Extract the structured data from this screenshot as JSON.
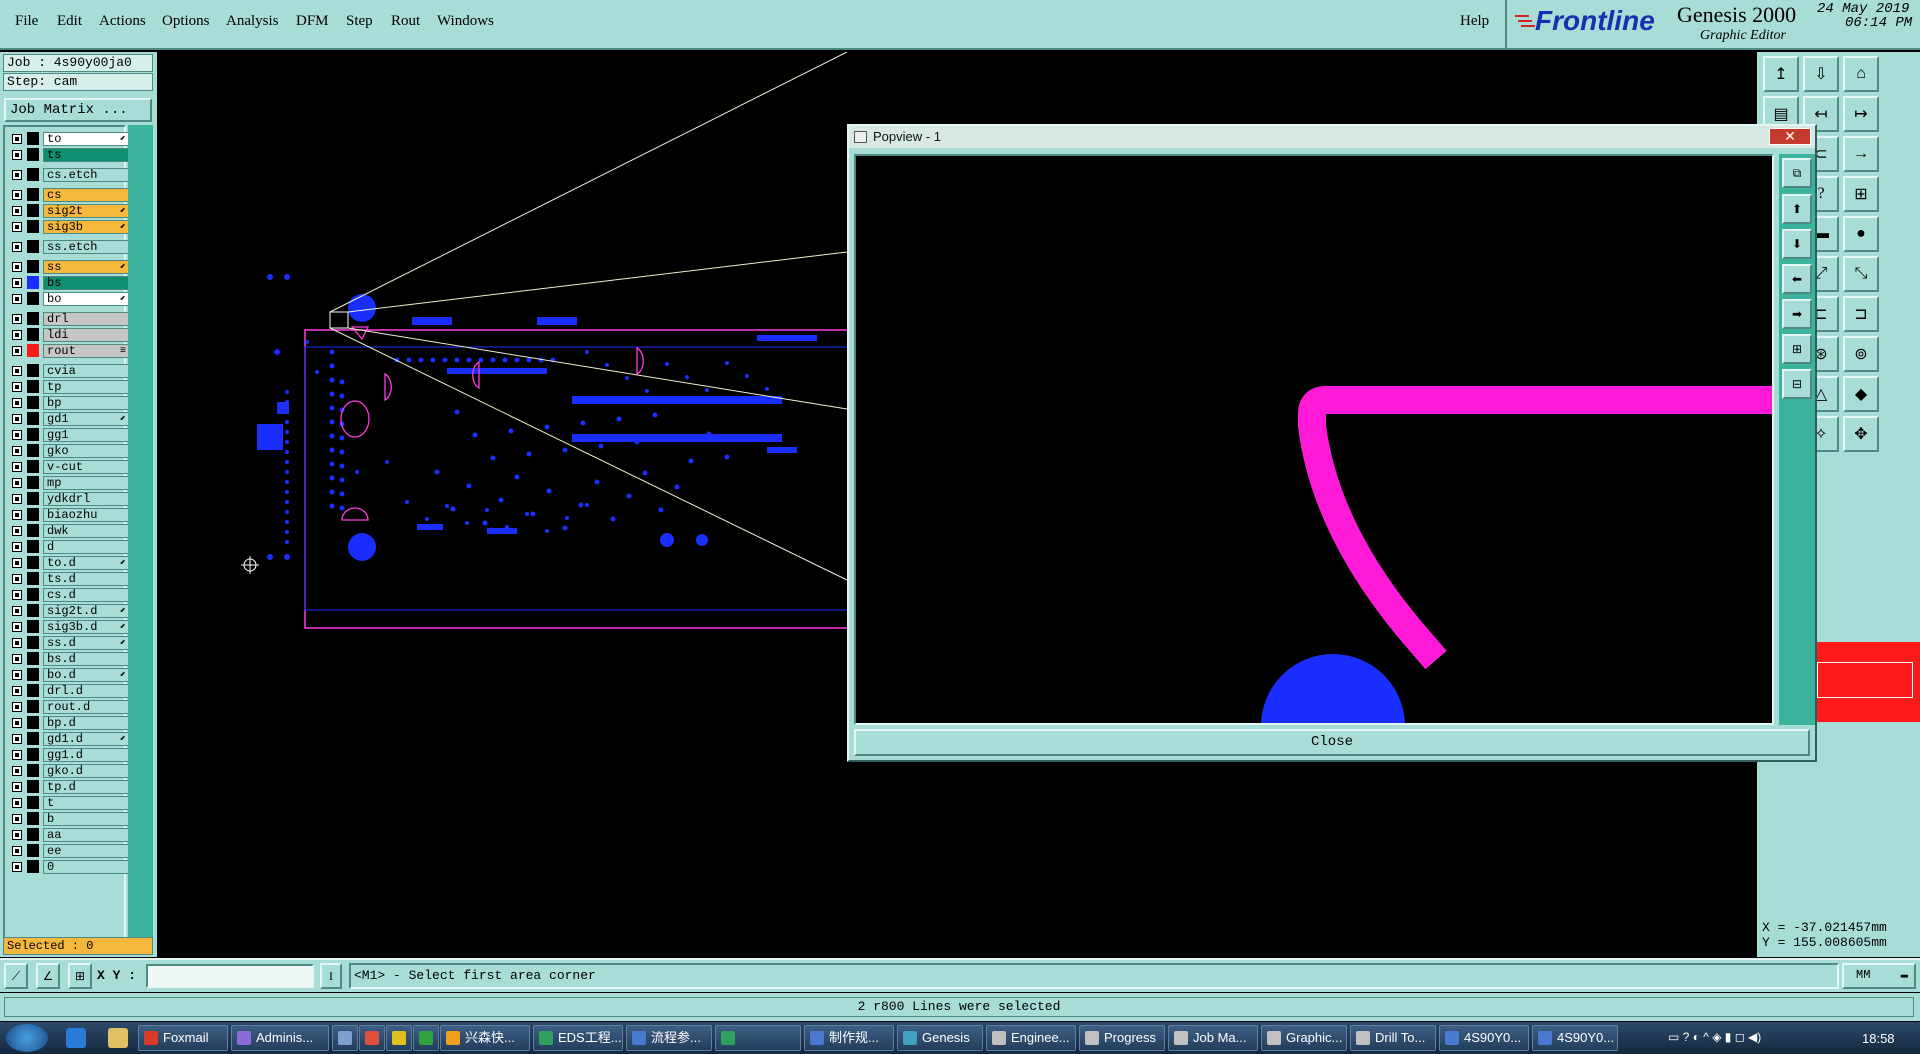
{
  "menubar": {
    "items": [
      "File",
      "Edit",
      "Actions",
      "Options",
      "Analysis",
      "DFM",
      "Step",
      "Rout",
      "Windows"
    ],
    "help": "Help"
  },
  "brand": {
    "logo": "Frontline",
    "product": "Genesis 2000",
    "subtitle": "Graphic Editor",
    "date": "24 May 2019",
    "time": "06:14 PM"
  },
  "job": {
    "job_label": "Job : 4s90y00ja0",
    "step_label": "Step: cam",
    "matrix_button": "Job Matrix ..."
  },
  "layers": [
    {
      "name": "to",
      "style": "ss",
      "flag": "⬋"
    },
    {
      "name": "ts",
      "style": "sm",
      "flag": ""
    },
    {
      "name": "cs.etch",
      "style": "",
      "flag": "",
      "gap": true
    },
    {
      "name": "cs",
      "style": "sig",
      "flag": "",
      "gap": true
    },
    {
      "name": "sig2t",
      "style": "sig",
      "flag": "⬋"
    },
    {
      "name": "sig3b",
      "style": "sig",
      "flag": "⬋"
    },
    {
      "name": "ss.etch",
      "style": "",
      "flag": "",
      "gap": true
    },
    {
      "name": "ss",
      "style": "sig",
      "flag": "⬋",
      "gap": true
    },
    {
      "name": "bs",
      "style": "sm",
      "flag": "",
      "swatch": "#1a2fff"
    },
    {
      "name": "bo",
      "style": "ss",
      "flag": "⬋"
    },
    {
      "name": "drl",
      "style": "gray",
      "flag": "",
      "gap": true
    },
    {
      "name": "ldi",
      "style": "gray",
      "flag": ""
    },
    {
      "name": "rout",
      "style": "gray",
      "flag": "≡",
      "swatch": "#ff1a1a"
    },
    {
      "name": "cvia",
      "style": "",
      "flag": "",
      "gap": true
    },
    {
      "name": "tp",
      "style": "",
      "flag": ""
    },
    {
      "name": "bp",
      "style": "",
      "flag": ""
    },
    {
      "name": "gd1",
      "style": "",
      "flag": "⬋"
    },
    {
      "name": "gg1",
      "style": "",
      "flag": ""
    },
    {
      "name": "gko",
      "style": "",
      "flag": ""
    },
    {
      "name": "v-cut",
      "style": "",
      "flag": ""
    },
    {
      "name": "mp",
      "style": "",
      "flag": ""
    },
    {
      "name": "ydkdrl",
      "style": "",
      "flag": ""
    },
    {
      "name": "biaozhu",
      "style": "",
      "flag": ""
    },
    {
      "name": "dwk",
      "style": "",
      "flag": ""
    },
    {
      "name": "d",
      "style": "",
      "flag": ""
    },
    {
      "name": "to.d",
      "style": "",
      "flag": "⬋"
    },
    {
      "name": "ts.d",
      "style": "",
      "flag": ""
    },
    {
      "name": "cs.d",
      "style": "",
      "flag": ""
    },
    {
      "name": "sig2t.d",
      "style": "",
      "flag": "⬋"
    },
    {
      "name": "sig3b.d",
      "style": "",
      "flag": "⬋"
    },
    {
      "name": "ss.d",
      "style": "",
      "flag": "⬋"
    },
    {
      "name": "bs.d",
      "style": "",
      "flag": ""
    },
    {
      "name": "bo.d",
      "style": "",
      "flag": "⬋"
    },
    {
      "name": "drl.d",
      "style": "",
      "flag": ""
    },
    {
      "name": "rout.d",
      "style": "",
      "flag": ""
    },
    {
      "name": "bp.d",
      "style": "",
      "flag": ""
    },
    {
      "name": "gd1.d",
      "style": "",
      "flag": "⬋"
    },
    {
      "name": "gg1.d",
      "style": "",
      "flag": ""
    },
    {
      "name": "gko.d",
      "style": "",
      "flag": ""
    },
    {
      "name": "tp.d",
      "style": "",
      "flag": ""
    },
    {
      "name": "t",
      "style": "",
      "flag": ""
    },
    {
      "name": "b",
      "style": "",
      "flag": ""
    },
    {
      "name": "aa",
      "style": "",
      "flag": ""
    },
    {
      "name": "ee",
      "style": "",
      "flag": ""
    },
    {
      "name": "0",
      "style": "",
      "flag": ""
    }
  ],
  "selected": "Selected : 0",
  "popview": {
    "title": "Popview - 1",
    "close_button": "Close",
    "close_x": "✕"
  },
  "coords": {
    "x": "X = -37.021457mm",
    "y": "Y = 155.008605mm"
  },
  "cmd": {
    "xy_label": "X Y :",
    "xy_value": "",
    "prompt": "<M1> - Select first area corner",
    "units": "MM"
  },
  "status": "2 r800 Lines were selected",
  "taskbar": {
    "tasks": [
      {
        "label": "Foxmail",
        "color": "#d83a2a"
      },
      {
        "label": "Adminis...",
        "color": "#8b6bd8"
      },
      {
        "label": "",
        "color": "#7aa0d0"
      },
      {
        "label": "",
        "color": "#e0503a"
      },
      {
        "label": "",
        "color": "#e0c020"
      },
      {
        "label": "",
        "color": "#30a040"
      },
      {
        "label": "兴森快...",
        "color": "#f0a020"
      },
      {
        "label": "EDS工程...",
        "color": "#30a060"
      },
      {
        "label": "流程参...",
        "color": "#4a7ad0"
      },
      {
        "label": "",
        "color": "#30a060"
      },
      {
        "label": "制作规...",
        "color": "#4a7ad0"
      },
      {
        "label": "Genesis",
        "color": "#40a0c0"
      },
      {
        "label": "Enginee...",
        "color": "#c0c0c0"
      },
      {
        "label": "Progress",
        "color": "#c0c0c0"
      },
      {
        "label": "Job Ma...",
        "color": "#c0c0c0"
      },
      {
        "label": "Graphic...",
        "color": "#c0c0c0"
      },
      {
        "label": "Drill To...",
        "color": "#c0c0c0"
      },
      {
        "label": "4S90Y0...",
        "color": "#4a7ad0"
      },
      {
        "label": "4S90Y0...",
        "color": "#4a7ad0"
      }
    ],
    "clock": "18:58"
  },
  "colors": {
    "panel": "#a8dcd6",
    "copper": "#1a2fff",
    "rout": "#ff1ad8",
    "outline": "#ff3ce0"
  }
}
